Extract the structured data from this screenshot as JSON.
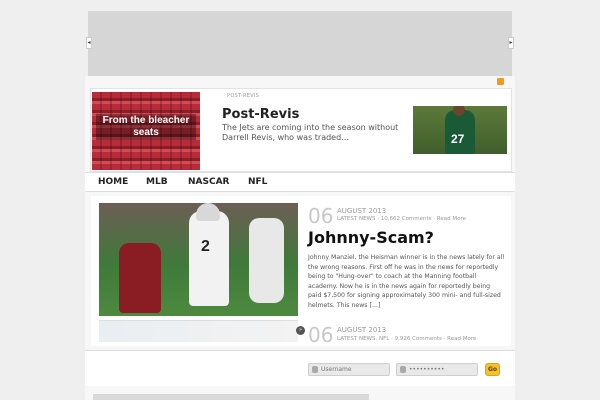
{
  "banner": {
    "prev_symbol": "◂",
    "next_symbol": "▸"
  },
  "header": {
    "breadcrumb": "POST-REVIS",
    "logo_text": "From the bleacher seats",
    "featured_title": "Post-Revis",
    "featured_excerpt": "The Jets are coming into the season without Darrell Revis, who was traded…",
    "featured_player_number": "27"
  },
  "nav": {
    "items": [
      "HOME",
      "MLB",
      "NASCAR",
      "NFL"
    ]
  },
  "posts": [
    {
      "day": "06",
      "month": "AUGUST 2013",
      "categories": "LATEST NEWS",
      "comments": "10,662 Comments",
      "read_more": "Read More",
      "title": "Johnny-Scam?",
      "excerpt": "Johnny Manziel, the Heisman winner is in the news lately for all the wrong reasons. First off he was in the news for reportedly being to \"Hung-over\" to coach at the Manning football academy. Now he is in the news again for reportedly being paid $7,500 for signing approximately 300 mini- and full-sized helmets. This news […]",
      "image_jersey_number": "2"
    },
    {
      "day": "06",
      "month": "AUGUST 2013",
      "categories": "LATEST NEWS, NFL",
      "comments": "9,926 Comments",
      "read_more": "Read More"
    }
  ],
  "slider": {
    "next_symbol": "»"
  },
  "login": {
    "username_placeholder": "Username",
    "password_value": "••••••••••",
    "go_label": "Go"
  },
  "colors": {
    "accent_go": "#f4c12c",
    "rss": "#f39a1b"
  }
}
